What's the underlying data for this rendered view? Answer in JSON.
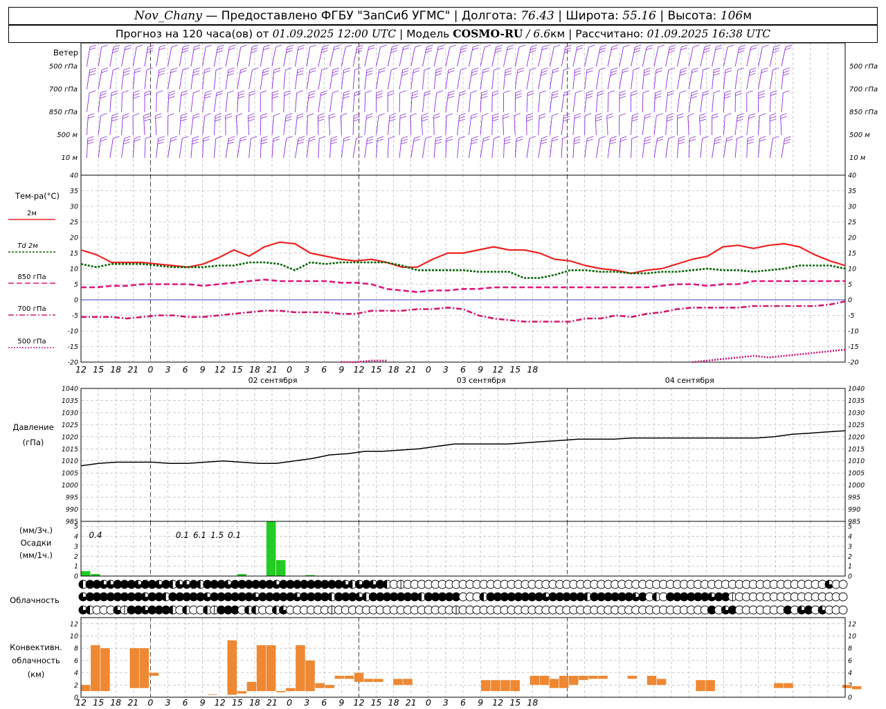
{
  "header": {
    "station": "Nov_Chany",
    "provider": " — Предоставлено ФГБУ \"ЗапСиб УГМС\" | ",
    "lon_label": "Долгота: ",
    "lon": "76.43",
    "lat_label": " | Широта: ",
    "lat": "55.16",
    "alt_label": " | Высота: ",
    "alt": "106",
    "alt_unit": "м",
    "forecast_prefix": "Прогноз на 120 часа(ов) от ",
    "forecast_start": "01.09.2025 12:00 UTC",
    "model_label": " | Модель ",
    "model": "COSMO-RU",
    "model_res": " / 6.6",
    "model_res_unit": "км",
    "calc_label": " | Рассчитано: ",
    "calc_time": "01.09.2025 16:38 UTC"
  },
  "labels": {
    "wind": "Ветер",
    "wind_levels": [
      "500 гПа",
      "700 гПа",
      "850 гПа",
      "500 м",
      "10 м"
    ],
    "temp_title": "Тем-ра(°C)",
    "temp_legend": [
      "2м",
      "Td  2м",
      "850 гПа",
      "700 гПа",
      "500 гПа"
    ],
    "pressure": "Давление",
    "pressure_unit": "(гПа)",
    "precip_top": "(мм/3ч.)",
    "precip": "Осадки",
    "precip_bottom": "(мм/1ч.)",
    "cloud": "Облачность",
    "conv1": "Конвективн.",
    "conv2": "облачность",
    "conv_unit": "(км)"
  },
  "colors": {
    "wind": "#8a2be2",
    "t2m": "#ee2222",
    "td": "#006400",
    "t850": "#e0157e",
    "t700": "#d0156e",
    "t500": "#cc1177",
    "zero": "#0000cc",
    "pressure": "#000000",
    "precip": "#22cc22",
    "conv": "#ee8833",
    "grid": "#aaaaaa"
  },
  "chart_data": {
    "type": "line",
    "x_hours": [
      "12",
      "15",
      "18",
      "21",
      "0",
      "3",
      "6",
      "9",
      "12",
      "15",
      "18",
      "21",
      "0",
      "3",
      "6",
      "9",
      "12",
      "15",
      "18",
      "21",
      "0",
      "3",
      "6",
      "9",
      "12",
      "15",
      "18"
    ],
    "day_labels": [
      "02 сентября",
      "03 сентября",
      "04 сентября"
    ],
    "temperature": {
      "ylim": [
        -20,
        40
      ],
      "ticks": [
        40,
        35,
        30,
        25,
        20,
        15,
        10,
        5,
        0,
        -5,
        -10,
        -15,
        -20
      ],
      "series": [
        {
          "name": "2м",
          "values": [
            16,
            14.5,
            12,
            12,
            12,
            11.5,
            11,
            10.5,
            11.5,
            13.5,
            16,
            14,
            17,
            18.5,
            18,
            15,
            14,
            13,
            12.5,
            13,
            12,
            10.5,
            10.5,
            13,
            15,
            15,
            16,
            17,
            16,
            16,
            15,
            13,
            12.5,
            11,
            10,
            9.5,
            8.5,
            9.5,
            10,
            11.5,
            13,
            14,
            17,
            17.5,
            16.5,
            17.5,
            18,
            17,
            14.5,
            12.5,
            11
          ]
        },
        {
          "name": "Td 2м",
          "values": [
            11.5,
            10.5,
            11.5,
            11.5,
            11.5,
            11,
            10.5,
            10.5,
            10.5,
            11,
            11,
            12,
            12,
            11.5,
            9.5,
            12,
            11.5,
            12,
            12,
            12,
            12,
            11,
            9.5,
            9.5,
            9.5,
            9.5,
            9,
            9,
            9,
            7,
            7,
            8,
            9.5,
            9.5,
            9,
            9,
            8.5,
            8.5,
            9,
            9,
            9.5,
            10,
            9.5,
            9.5,
            9,
            9.5,
            10,
            11,
            11,
            11,
            10
          ]
        },
        {
          "name": "850 гПа",
          "values": [
            4,
            4,
            4.5,
            4.5,
            5,
            5,
            5,
            5,
            4.5,
            5,
            5.5,
            6,
            6.5,
            6,
            6,
            6,
            6,
            5.5,
            5.5,
            5,
            3.5,
            3,
            2.5,
            3,
            3,
            3.5,
            3.5,
            4,
            4,
            4,
            4,
            4,
            4,
            4,
            4,
            4,
            4,
            4,
            4.5,
            5,
            5,
            4.5,
            5,
            5,
            6,
            6,
            6,
            6,
            6,
            6,
            6
          ]
        },
        {
          "name": "700 гПа",
          "values": [
            -5.5,
            -5.5,
            -5.5,
            -6,
            -5.5,
            -5,
            -5,
            -5.5,
            -5.5,
            -5,
            -4.5,
            -4,
            -3.5,
            -3.5,
            -4,
            -4,
            -4,
            -4.5,
            -4.5,
            -3.5,
            -3.5,
            -3.5,
            -3,
            -3,
            -2.5,
            -3,
            -5,
            -6,
            -6.5,
            -7,
            -7,
            -7,
            -7,
            -6,
            -6,
            -5,
            -5.5,
            -4.5,
            -4,
            -3,
            -2.5,
            -2.5,
            -2.5,
            -2.5,
            -2,
            -2,
            -2,
            -2,
            -2,
            -1.5,
            -0.5
          ]
        },
        {
          "name": "500 гПа",
          "values": [
            null,
            null,
            null,
            null,
            null,
            null,
            null,
            null,
            null,
            null,
            null,
            null,
            null,
            null,
            null,
            null,
            null,
            -20,
            -20,
            -19.5,
            -19.5,
            null,
            null,
            null,
            null,
            null,
            null,
            null,
            null,
            null,
            null,
            null,
            null,
            null,
            null,
            null,
            null,
            null,
            null,
            null,
            -20,
            -19.5,
            -19,
            -18.5,
            -18,
            -18.5,
            -18,
            -17.5,
            -17,
            -16.5,
            -16
          ]
        }
      ]
    },
    "pressure": {
      "ylim": [
        985,
        1040
      ],
      "ticks": [
        1040,
        1035,
        1030,
        1025,
        1020,
        1015,
        1010,
        1005,
        1000,
        995,
        990,
        985
      ],
      "values": [
        1008,
        1009,
        1009.5,
        1009.5,
        1009.5,
        1009,
        1009,
        1009.5,
        1010,
        1009.5,
        1009,
        1009,
        1010,
        1011,
        1012.5,
        1013,
        1014,
        1014,
        1014.5,
        1015,
        1016,
        1017,
        1017,
        1017,
        1017,
        1017.5,
        1018,
        1018.5,
        1019,
        1019,
        1019,
        1019.5,
        1019.5,
        1019.5,
        1019.5,
        1019.5,
        1019.5,
        1019.5,
        1019.5,
        1020,
        1021,
        1021.5,
        1022,
        1022.5
      ]
    },
    "precipitation": {
      "ylim": [
        0,
        5.5
      ],
      "ticks": [
        5,
        4,
        3,
        2,
        1,
        0
      ],
      "hourly": [
        [
          0,
          0.5
        ],
        [
          1,
          0.2
        ],
        [
          16,
          0.2
        ],
        [
          19,
          6.3
        ],
        [
          20,
          1.6
        ],
        [
          23,
          0.1
        ]
      ],
      "labels_3h": [
        {
          "idx": 0,
          "text": "0.4"
        },
        {
          "idx": 5,
          "text": "0.1"
        },
        {
          "idx": 6,
          "text": "6.1"
        },
        {
          "idx": 7,
          "text": "1.5"
        },
        {
          "idx": 8,
          "text": "0.1"
        }
      ]
    },
    "cloudiness": {
      "legend": "0=clear,1=quarter,2=half,3=three-quarters,4=overcast",
      "row1": [
        2,
        4,
        4,
        3,
        3,
        4,
        4,
        4,
        3,
        4,
        4,
        3,
        4,
        2,
        3,
        3,
        4,
        2,
        4,
        4,
        4,
        3,
        4,
        4,
        4,
        4,
        4,
        4,
        3,
        4,
        4,
        4,
        4,
        4,
        4,
        4,
        4,
        4,
        3,
        2,
        3,
        4,
        3,
        4,
        2,
        0,
        1,
        0,
        0,
        0,
        0,
        0,
        0,
        0,
        0,
        0,
        0,
        0,
        0,
        0,
        0,
        0,
        0,
        0,
        0,
        0,
        0,
        0,
        0,
        0,
        0,
        0,
        0,
        0,
        0,
        0,
        0,
        0,
        0,
        0,
        0,
        0,
        0,
        0,
        0,
        0,
        0,
        0,
        0,
        0,
        0,
        0,
        0,
        0,
        0,
        0,
        0,
        0,
        0,
        0,
        0,
        0,
        0,
        0,
        0,
        0,
        0,
        0,
        3,
        0,
        0
      ],
      "row2": [
        3,
        4,
        4,
        4,
        4,
        4,
        4,
        4,
        4,
        3,
        4,
        4,
        2,
        4,
        4,
        4,
        4,
        4,
        3,
        4,
        4,
        4,
        4,
        4,
        4,
        3,
        4,
        4,
        4,
        4,
        4,
        3,
        4,
        4,
        4,
        4,
        2,
        4,
        4,
        4,
        3,
        2,
        4,
        4,
        4,
        4,
        4,
        4,
        4,
        2,
        4,
        4,
        4,
        4,
        4,
        0,
        0,
        0,
        2,
        4,
        4,
        4,
        4,
        4,
        4,
        4,
        4,
        3,
        4,
        4,
        4,
        4,
        4,
        2,
        4,
        4,
        4,
        4,
        4,
        4,
        3,
        4,
        0,
        2,
        0,
        4,
        4,
        4,
        4,
        4,
        4,
        3,
        4,
        4,
        1,
        0,
        0,
        0,
        0,
        0,
        0,
        0,
        0,
        0,
        0,
        0,
        0,
        0,
        0,
        0,
        0
      ],
      "row3": [
        3,
        2,
        0,
        0,
        0,
        3,
        1,
        4,
        4,
        3,
        4,
        4,
        4,
        2,
        0,
        2,
        0,
        0,
        2,
        1,
        4,
        4,
        4,
        0,
        2,
        2,
        0,
        0,
        2,
        3,
        0,
        0,
        0,
        0,
        0,
        0,
        1,
        0,
        0,
        0,
        0,
        0,
        0,
        0,
        0,
        0,
        0,
        0,
        0,
        0,
        0,
        0,
        0,
        0,
        1,
        0,
        0,
        0,
        0,
        0,
        0,
        0,
        0,
        0,
        0,
        0,
        0,
        0,
        0,
        0,
        0,
        0,
        0,
        0,
        0,
        0,
        0,
        0,
        0,
        0,
        0,
        0,
        0,
        0,
        0,
        0,
        0,
        0,
        0,
        0,
        0,
        4,
        0,
        3,
        4,
        0,
        0,
        0,
        0,
        0,
        0,
        0,
        4,
        0,
        3,
        4,
        0,
        3,
        0,
        0,
        0
      ]
    },
    "convective": {
      "ylim": [
        0,
        13
      ],
      "ticks": [
        12,
        10,
        8,
        6,
        4,
        2,
        0
      ],
      "bars": [
        [
          0,
          1,
          2
        ],
        [
          1,
          1,
          8.5
        ],
        [
          2,
          1,
          8
        ],
        [
          5,
          1.5,
          8
        ],
        [
          6,
          1.5,
          8
        ],
        [
          7,
          3.5,
          4
        ],
        [
          13,
          0.4,
          0.5
        ],
        [
          15,
          0.4,
          9.3
        ],
        [
          16,
          0.6,
          1
        ],
        [
          17,
          1,
          2.5
        ],
        [
          18,
          1,
          8.5
        ],
        [
          19,
          1,
          8.5
        ],
        [
          20,
          0.8,
          1
        ],
        [
          21,
          1,
          1.5
        ],
        [
          22,
          1,
          8.5
        ],
        [
          23,
          1,
          6
        ],
        [
          24,
          1.5,
          2.3
        ],
        [
          25,
          1.5,
          2
        ],
        [
          26,
          3,
          3.5
        ],
        [
          27,
          3,
          3.5
        ],
        [
          28,
          2.5,
          4
        ],
        [
          29,
          2.5,
          3
        ],
        [
          30,
          2.5,
          3
        ],
        [
          32,
          2,
          3
        ],
        [
          33,
          2,
          3
        ],
        [
          41,
          1,
          2.8
        ],
        [
          42,
          1,
          2.8
        ],
        [
          43,
          1,
          2.8
        ],
        [
          44,
          1,
          2.8
        ],
        [
          46,
          2,
          3.5
        ],
        [
          47,
          2,
          3.5
        ],
        [
          48,
          1.5,
          3
        ],
        [
          49,
          1.5,
          3.5
        ],
        [
          50,
          2,
          3.5
        ],
        [
          51,
          2.8,
          3.5
        ],
        [
          52,
          3,
          3.5
        ],
        [
          53,
          3,
          3.5
        ],
        [
          56,
          3,
          3.5
        ],
        [
          58,
          2,
          3.5
        ],
        [
          59,
          2,
          3
        ],
        [
          63,
          1,
          2.8
        ],
        [
          64,
          1,
          2.8
        ],
        [
          71,
          1.5,
          2.3
        ],
        [
          72,
          1.5,
          2.3
        ],
        [
          78,
          1.5,
          2
        ],
        [
          79,
          1.3,
          1.8
        ]
      ]
    }
  }
}
